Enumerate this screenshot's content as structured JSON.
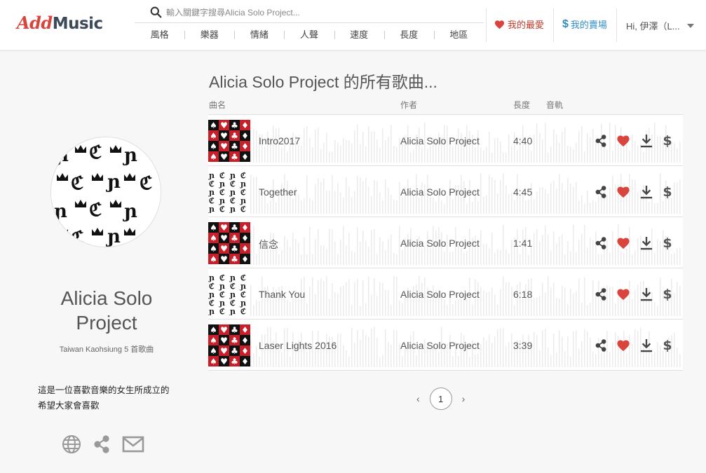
{
  "brand": {
    "add": "Add",
    "music": "Music"
  },
  "search": {
    "placeholder": "輸入關鍵字搜尋Alicia Solo Project..."
  },
  "categories": [
    "風格",
    "樂器",
    "情緒",
    "人聲",
    "速度",
    "長度",
    "地區"
  ],
  "header": {
    "favorites": "我的最愛",
    "store": "我的賣場",
    "store_symbol": "$",
    "greeting": "Hi, 伊澤（L..."
  },
  "artist": {
    "name": "Alicia Solo Project",
    "meta": "Taiwan Kaohsiung 5 首歌曲",
    "description": "這是一位喜歡音樂的女生所成立的 希望大家會喜歡"
  },
  "list": {
    "title": "Alicia Solo Project 的所有歌曲...",
    "columns": {
      "name": "曲名",
      "artist": "作者",
      "length": "長度",
      "track": "音軌"
    },
    "songs": [
      {
        "title": "Intro2017",
        "artist": "Alicia Solo Project",
        "length": "4:40",
        "cover": "cards"
      },
      {
        "title": "Together",
        "artist": "Alicia Solo Project",
        "length": "4:45",
        "cover": "gothic"
      },
      {
        "title": "信念",
        "artist": "Alicia Solo Project",
        "length": "1:41",
        "cover": "cards"
      },
      {
        "title": "Thank You",
        "artist": "Alicia Solo Project",
        "length": "6:18",
        "cover": "gothic"
      },
      {
        "title": "Laser Lights 2016",
        "artist": "Alicia Solo Project",
        "length": "3:39",
        "cover": "cards"
      }
    ],
    "buy_symbol": "$"
  },
  "pagination": {
    "prev": "‹",
    "current": "1",
    "next": "›"
  },
  "colors": {
    "brand_red": "#d9453d",
    "heart": "#d9453d",
    "store_blue": "#2f8fc4"
  }
}
